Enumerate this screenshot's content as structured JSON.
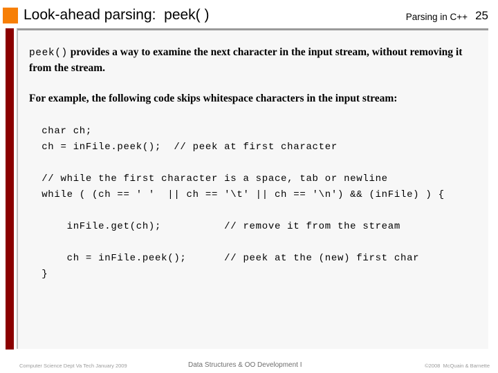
{
  "header": {
    "title": "Look-ahead parsing:  peek( )",
    "course": "Parsing in C++",
    "page_number": "25",
    "bullet_color": "#F77F06"
  },
  "accent": {
    "bar_color": "#8B0000",
    "panel_background": "#F7F7F7",
    "panel_border_color": "#9A9A9A"
  },
  "body": {
    "intro_code": "peek()",
    "intro_text": " provides a way to examine the next character in the input stream, without removing it from the stream.",
    "example_text": "For example, the following code skips whitespace characters in the input stream:"
  },
  "code": {
    "lines": [
      "  char ch;",
      "  ch = inFile.peek();  // peek at first character",
      "",
      "  // while the first character is a space, tab or newline",
      "  while ( (ch == ' '  || ch == '\\t' || ch == '\\n') && (inFile) ) {",
      "",
      "      inFile.get(ch);          // remove it from the stream",
      "",
      "      ch = inFile.peek();      // peek at the (new) first char",
      "  }"
    ]
  },
  "footer": {
    "left": "Computer Science Dept Va Tech January 2009",
    "center": "Data Structures & OO Development I",
    "right": "©2008  McQuain & Barnette"
  }
}
